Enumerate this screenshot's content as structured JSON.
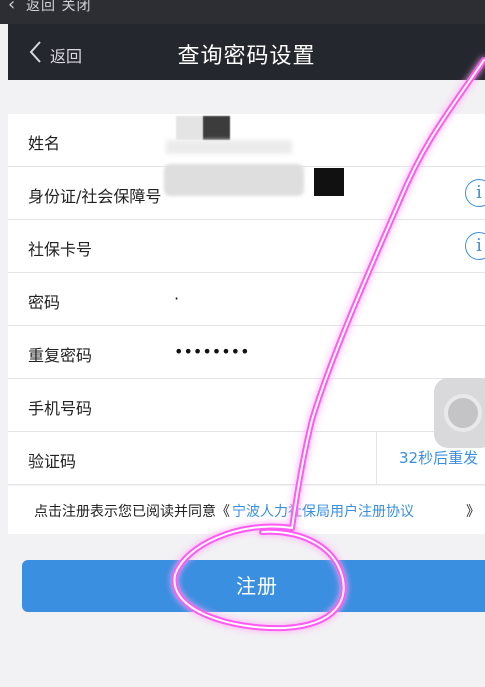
{
  "top_strip": {
    "text": "返回  关闭"
  },
  "navbar": {
    "back_label": "返回",
    "title": "查询密码设置"
  },
  "form": {
    "rows": [
      {
        "label": "姓名",
        "value": ""
      },
      {
        "label": "身份证/社会保障号",
        "value": ""
      },
      {
        "label": "社保卡号",
        "value": ""
      },
      {
        "label": "密码",
        "value": "·"
      },
      {
        "label": "重复密码",
        "value": "••••••••"
      },
      {
        "label": "手机号码",
        "value": ""
      },
      {
        "label": "验证码",
        "value": ""
      }
    ],
    "info_glyph": "i",
    "resend_label": "32秒后重发"
  },
  "agreement": {
    "text": "点击注册表示您已阅读并同意《",
    "link": "宁波人力社保局用户注册协议",
    "close": "》"
  },
  "register": {
    "label": "注册"
  },
  "colors": {
    "accent": "#3a8fe0",
    "navbar": "#24272e",
    "annotation": "#ff3df0"
  }
}
